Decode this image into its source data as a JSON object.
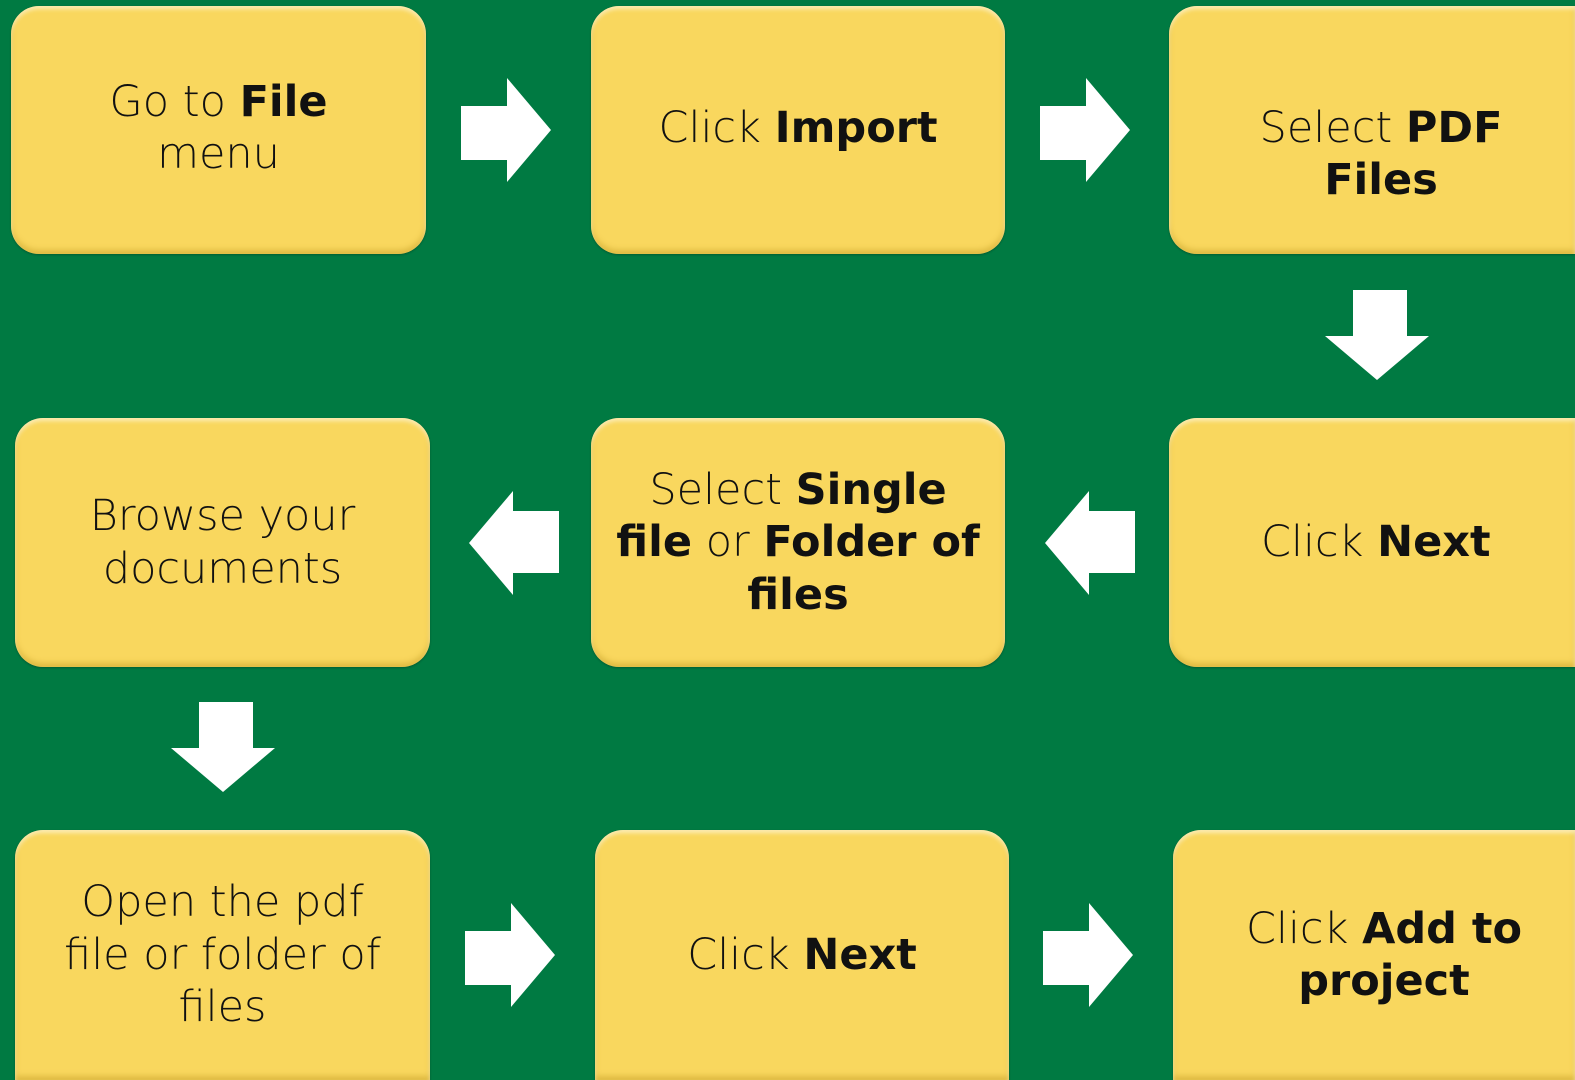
{
  "steps": [
    {
      "id": "go-to-file",
      "parts": [
        {
          "t": "Go to ",
          "b": false
        },
        {
          "t": "File",
          "b": true
        },
        {
          "t": "\nmenu",
          "b": false
        }
      ]
    },
    {
      "id": "click-import",
      "parts": [
        {
          "t": "Click ",
          "b": false
        },
        {
          "t": "Import",
          "b": true
        }
      ]
    },
    {
      "id": "select-pdf-files",
      "parts": [
        {
          "t": "Select ",
          "b": false
        },
        {
          "t": "PDF Files",
          "b": true
        }
      ]
    },
    {
      "id": "click-next-1",
      "parts": [
        {
          "t": "Click ",
          "b": false
        },
        {
          "t": "Next",
          "b": true
        }
      ]
    },
    {
      "id": "select-single-or-folder",
      "parts": [
        {
          "t": "Select ",
          "b": false
        },
        {
          "t": "Single",
          "b": true
        },
        {
          "t": "\n",
          "b": false
        },
        {
          "t": "file",
          "b": true
        },
        {
          "t": " or ",
          "b": false
        },
        {
          "t": "Folder of",
          "b": true
        },
        {
          "t": "\n",
          "b": false
        },
        {
          "t": "files",
          "b": true
        }
      ]
    },
    {
      "id": "browse-documents",
      "parts": [
        {
          "t": "Browse your\ndocuments",
          "b": false
        }
      ]
    },
    {
      "id": "open-pdf",
      "parts": [
        {
          "t": "Open the pdf\nfile or folder of\nfiles",
          "b": false
        }
      ]
    },
    {
      "id": "click-next-2",
      "parts": [
        {
          "t": "Click ",
          "b": false
        },
        {
          "t": "Next",
          "b": true
        }
      ]
    },
    {
      "id": "click-add-to-project",
      "parts": [
        {
          "t": "Click ",
          "b": false
        },
        {
          "t": "Add to",
          "b": true
        },
        {
          "t": "\n",
          "b": false
        },
        {
          "t": "project",
          "b": true
        }
      ]
    }
  ],
  "colors": {
    "background": "#007a42",
    "box": "#f9d75e",
    "arrow": "#ffffff",
    "text": "#111111"
  },
  "arrows": [
    "right-arrow",
    "right-arrow",
    "down-arrow",
    "left-arrow",
    "left-arrow",
    "down-arrow",
    "right-arrow",
    "right-arrow"
  ]
}
